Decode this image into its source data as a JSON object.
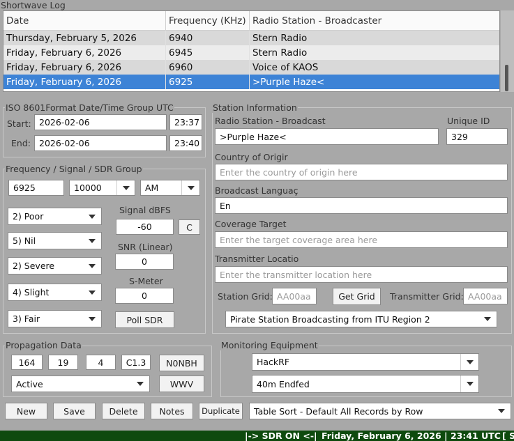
{
  "log": {
    "title": "Shortwave Log",
    "columns": [
      "Date",
      "Frequency (KHz)",
      "Radio Station - Broadcaster"
    ],
    "rows": [
      {
        "date": "Thursday, February 5, 2026",
        "freq": "6940",
        "station": "Stern Radio"
      },
      {
        "date": "Friday, February 6, 2026",
        "freq": "6945",
        "station": "Stern Radio"
      },
      {
        "date": "Friday, February 6, 2026",
        "freq": "6960",
        "station": "Voice of KAOS"
      },
      {
        "date": "Friday, February 6, 2026",
        "freq": "6925",
        "station": ">Purple Haze<"
      }
    ],
    "selected_row": 3
  },
  "datetime": {
    "legend": "ISO 8601Format Date/Time Group UTC",
    "start_label": "Start:",
    "start_date": "2026-02-06",
    "start_time": "23:37",
    "end_label": "End:",
    "end_date": "2026-02-06",
    "end_time": "23:40"
  },
  "freq_group": {
    "legend": "Frequency / Signal / SDR Group",
    "frequency": "6925",
    "bandwidth": "10000",
    "mode": "AM",
    "signal_label": "Signal dBFS",
    "signal_value": "-60",
    "signal_btn": "C",
    "snr_label": "SNR (Linear)",
    "snr_value": "0",
    "smeter_label": "S-Meter",
    "smeter_value": "0",
    "poll_btn": "Poll SDR",
    "combo_1": "2) Poor",
    "combo_2": "5) Nil",
    "combo_3": "2) Severe",
    "combo_4": "4) Slight",
    "combo_5": "3) Fair"
  },
  "station": {
    "legend": "Station Information",
    "broadcast_label": "Radio Station - Broadcast",
    "broadcast_value": ">Purple Haze<",
    "uid_label": "Unique  ID",
    "uid_value": "329",
    "country_label": "Country of Origir",
    "country_placeholder": "Enter the country of origin here",
    "language_label": "Broadcast Languaç",
    "language_value": "En",
    "coverage_label": "Coverage Target",
    "coverage_placeholder": "Enter the target coverage area here",
    "tx_label": "Transmitter Locatio",
    "tx_placeholder": "Enter the transmitter location here",
    "grid_label": "Station Grid:",
    "grid_placeholder": "AA00aa",
    "get_grid_btn": "Get Grid",
    "tx_grid_label": "Transmitter Grid:",
    "tx_grid_placeholder": "AA00aa",
    "region_value": "Pirate Station Broadcasting from ITU Region 2"
  },
  "propagation": {
    "legend": "Propagation Data",
    "v1": "164",
    "v2": "19",
    "v3": "4",
    "v4": "C1.3",
    "btn1": "N0NBH",
    "status_value": "Active",
    "btn2": "WWV"
  },
  "monitoring": {
    "legend": "Monitoring Equipment",
    "receiver": "HackRF",
    "antenna": "40m Endfed"
  },
  "actions": {
    "new": "New",
    "save": "Save",
    "delete": "Delete",
    "notes": "Notes",
    "duplicate": "Duplicate",
    "sort_value": "Table Sort - Default All Records by Row"
  },
  "statusbar": {
    "sdr": "|-> SDR ON <-|",
    "datetime": "Friday, February 6, 2026 | 23:41  UTC",
    "trail": "[ S"
  }
}
